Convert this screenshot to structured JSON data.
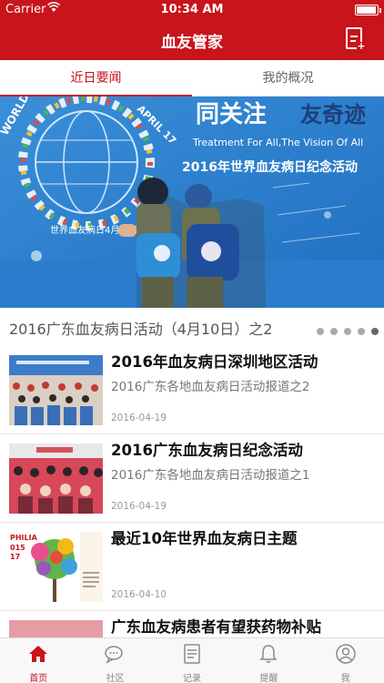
{
  "status_bar": {
    "carrier": "Carrier",
    "time": "10:34 AM"
  },
  "header": {
    "title": "血友管家",
    "right_icon": "new-document-icon"
  },
  "tabs": [
    {
      "label": "近日要闻",
      "active": true
    },
    {
      "label": "我的概况",
      "active": false
    }
  ],
  "banner": {
    "poster_lines": [
      "同关注",
      "友奇迹",
      "Treatment For All,The Vision Of All",
      "2016年世界血友病日纪念活动",
      "世界血友病日4月17日",
      "WORLD",
      "APRIL 17"
    ],
    "caption": "2016广东血友病日活动（4月10日）之2",
    "page_count": 5,
    "active_page": 5
  },
  "news": [
    {
      "title": "2016年血友病日深圳地区活动",
      "subtitle": "2016广东各地血友病日活动报道之2",
      "date": "2016-04-19"
    },
    {
      "title": "2016广东血友病日纪念活动",
      "subtitle": "2016广东各地血友病日活动报道之1",
      "date": "2016-04-19"
    },
    {
      "title": "最近10年世界血友病日主题",
      "subtitle": "",
      "date": "2016-04-10",
      "thumb_text": [
        "PHILIA",
        "015",
        "17"
      ]
    },
    {
      "title": "广东血友病患者有望获药物补贴",
      "subtitle": "",
      "date": ""
    }
  ],
  "tabbar": [
    {
      "label": "首页",
      "icon": "home-icon",
      "active": true
    },
    {
      "label": "社区",
      "icon": "chat-bubbles-icon",
      "active": false
    },
    {
      "label": "记录",
      "icon": "record-document-icon",
      "active": false
    },
    {
      "label": "提醒",
      "icon": "bell-icon",
      "active": false
    },
    {
      "label": "我",
      "icon": "user-icon",
      "active": false
    }
  ],
  "colors": {
    "brand_red": "#c8141b",
    "tab_inactive": "#888888"
  }
}
